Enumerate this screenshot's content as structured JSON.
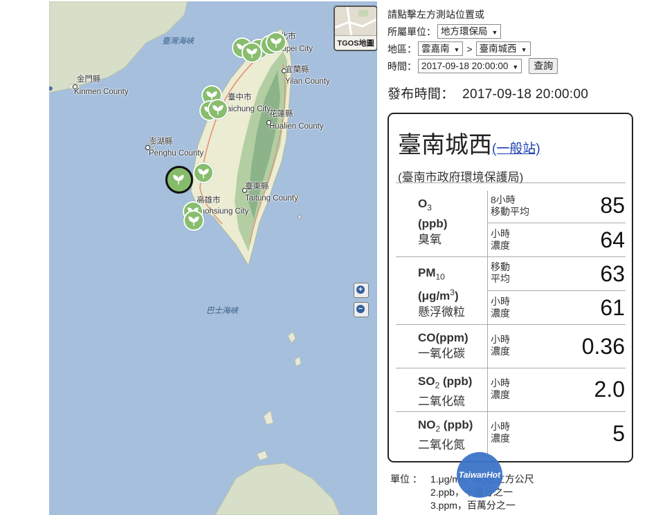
{
  "map": {
    "tgos_label": "TGOS地圖",
    "zoom_in": "+",
    "zoom_out": "−",
    "places": [
      {
        "zh": "臺灣海峽",
        "en": "",
        "sea": true
      },
      {
        "zh": "金門縣",
        "en": "Kinmen County"
      },
      {
        "zh": "臺北市",
        "en": "Taipei City"
      },
      {
        "zh": "宜蘭縣",
        "en": "Yilan County"
      },
      {
        "zh": "臺中市",
        "en": "Taichung City"
      },
      {
        "zh": "花蓮縣",
        "en": "Hualien County"
      },
      {
        "zh": "澎湖縣",
        "en": "Penghu County"
      },
      {
        "zh": "臺東縣",
        "en": "Taitung County"
      },
      {
        "zh": "高雄市",
        "en": "Kaohsiung City"
      },
      {
        "zh": "巴士海峽",
        "en": "",
        "sea": true
      }
    ]
  },
  "query": {
    "instruction": "請點擊左方測站位置或",
    "unit_label": "所屬單位：",
    "unit_value": "地方環保局",
    "area_label": "地區：",
    "region_value": "雲嘉南",
    "separator": ">",
    "station_value": "臺南城西",
    "time_label": "時間：",
    "time_value": "2017-09-18 20:00:00",
    "search_button": "查詢"
  },
  "publish": {
    "label": "發布時間：",
    "time": "2017-09-18 20:00:00"
  },
  "station": {
    "name": "臺南城西",
    "type_link": "(一般站)",
    "agency": "(臺南市政府環境保護局)",
    "o3": {
      "sym": "O",
      "sub": "3",
      "unit": "(ppb)",
      "cn": "臭氧",
      "k1": "8小時",
      "k1b": "移動平均",
      "v1": "85",
      "k2": "小時",
      "k2b": "濃度",
      "v2": "64"
    },
    "pm10": {
      "sym": "PM",
      "sub": "10",
      "unit_a": "(μg/m",
      "unit_sup": "3",
      "unit_b": ")",
      "cn": "懸浮微粒",
      "k1": "移動",
      "k1b": "平均",
      "v1": "63",
      "k2": "小時",
      "k2b": "濃度",
      "v2": "61"
    },
    "co": {
      "sym": "CO(ppm)",
      "cn": "一氧化碳",
      "k1": "小時",
      "k1b": "濃度",
      "v1": "0.36"
    },
    "so2": {
      "sym": "SO",
      "sub": "2",
      "unit": " (ppb)",
      "cn": "二氧化硫",
      "k1": "小時",
      "k1b": "濃度",
      "v1": "2.0"
    },
    "no2": {
      "sym": "NO",
      "sub": "2",
      "unit": " (ppb)",
      "cn": "二氧化氮",
      "k1": "小時",
      "k1b": "濃度",
      "v1": "5"
    }
  },
  "units": {
    "label": "單位 ：",
    "lines": [
      "1.μg/m³，微克/立方公尺",
      "2.ppb，十億分之一",
      "3.ppm，百萬分之一"
    ]
  },
  "watermark": {
    "logo_text": "TaiwanHot"
  },
  "colors": {
    "station": "#88bd6e",
    "sea": "#a5bfdd",
    "link": "#1a3fb0"
  }
}
